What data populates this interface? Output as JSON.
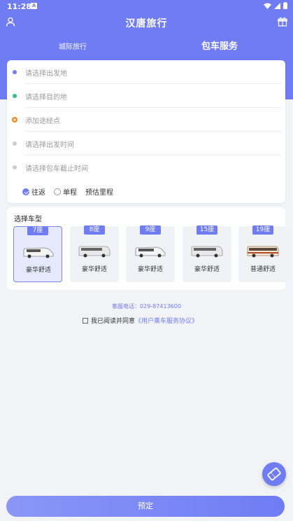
{
  "status_bar": {
    "time": "11:28",
    "notification": "A"
  },
  "app": {
    "title": "汉唐旅行"
  },
  "tabs": [
    {
      "label": "城际旅行",
      "active": false
    },
    {
      "label": "包车服务",
      "active": true
    }
  ],
  "form": {
    "rows": [
      {
        "placeholder": "请选择出发地",
        "dot_color": "#6f7cf4"
      },
      {
        "placeholder": "请选择目的地",
        "dot_color": "#2ec27e"
      },
      {
        "placeholder": "添加途经点",
        "dot_color": "#f08a24"
      },
      {
        "placeholder": "请选择出发时间",
        "dot_color": "#cccccc"
      },
      {
        "placeholder": "请选择包车截止时间",
        "dot_color": "#cccccc"
      }
    ],
    "trip_options": [
      {
        "label": "往返",
        "selected": true
      },
      {
        "label": "单程",
        "selected": false
      }
    ],
    "estimate_label": "预估里程"
  },
  "vehicles": {
    "title": "选择车型",
    "items": [
      {
        "seats": "7座",
        "label": "豪华舒适",
        "selected": true
      },
      {
        "seats": "8座",
        "label": "豪华舒适",
        "selected": false
      },
      {
        "seats": "9座",
        "label": "豪华舒适",
        "selected": false
      },
      {
        "seats": "15座",
        "label": "豪华舒适",
        "selected": false
      },
      {
        "seats": "19座",
        "label": "普通舒适",
        "selected": false
      }
    ]
  },
  "service": {
    "tel": "客服电话：029-87413600"
  },
  "agreement": {
    "text": "我已阅读并同意",
    "link": "《用户乘车服务协议》"
  },
  "book_button": "预定",
  "colors": {
    "primary": "#6f7cf4",
    "background": "#f2f3f7"
  }
}
